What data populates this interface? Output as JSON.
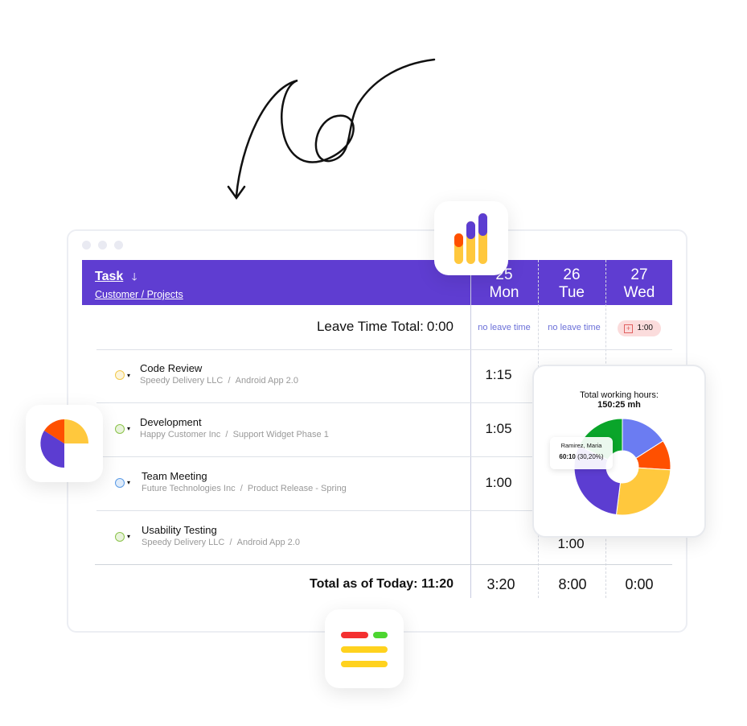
{
  "header": {
    "task_label": "Task",
    "sort_icon": "arrow-down-icon",
    "subtitle": "Customer / Projects",
    "days": [
      {
        "num": "25",
        "name": "Mon"
      },
      {
        "num": "26",
        "name": "Tue"
      },
      {
        "num": "27",
        "name": "Wed"
      }
    ]
  },
  "leave": {
    "label": "Leave Time Total:",
    "total": "0:00",
    "cells": [
      "no leave time",
      "no leave time"
    ],
    "badge": "1:00"
  },
  "rows": [
    {
      "name": "Code Review",
      "customer": "Speedy Delivery LLC",
      "project": "Android App 2.0",
      "color": "#f2c94c",
      "mon": "1:15",
      "tue": "",
      "wed": ""
    },
    {
      "name": "Development",
      "customer": "Happy Customer Inc",
      "project": "Support Widget Phase 1",
      "color": "#8bc34a",
      "mon": "1:05",
      "tue": "",
      "wed": ""
    },
    {
      "name": "Team Meeting",
      "customer": "Future Technologies Inc",
      "project": "Product Release - Spring",
      "color": "#5b9be6",
      "mon": "1:00",
      "tue": "",
      "wed": ""
    },
    {
      "name": "Usability Testing",
      "customer": "Speedy Delivery LLC",
      "project": "Android App 2.0",
      "color": "#8bc34a",
      "mon": "",
      "tue": "1:00",
      "wed": ""
    }
  ],
  "sep": "/",
  "totals": {
    "label": "Total as of Today: 11:20",
    "mon": "3:20",
    "tue": "8:00",
    "wed": "0:00"
  },
  "chart_data": {
    "type": "pie",
    "title": "Total working hours:",
    "total": "150:25 mh",
    "slices": [
      {
        "color": "#6b7cf2",
        "value": 16
      },
      {
        "color": "#ff5000",
        "value": 10
      },
      {
        "color": "#ffc83d",
        "value": 26
      },
      {
        "color": "#5c3dd1",
        "value": 30.2
      },
      {
        "color": "#0aa52a",
        "value": 17.8
      }
    ],
    "tooltip": {
      "name": "Ramirez, Maria",
      "value": "60:10",
      "pct": "(30,20%)"
    }
  },
  "colors": {
    "accent": "#5f3dd1"
  }
}
